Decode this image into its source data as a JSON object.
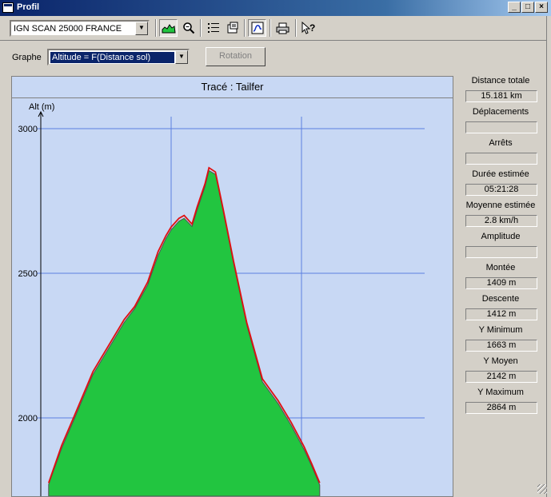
{
  "window": {
    "title": "Profil"
  },
  "toolbar": {
    "map_select": "IGN SCAN 25000 FRANCE",
    "icons": [
      "profile-icon",
      "zoom-icon",
      "list-icon",
      "properties-icon",
      "track-icon",
      "print-icon",
      "help-icon"
    ]
  },
  "graph": {
    "label": "Graphe",
    "select_value": "Altitude = F(Distance sol)",
    "rotation_label": "Rotation"
  },
  "chart_data": {
    "type": "area",
    "title": "Tracé : Tailfer",
    "ylabel": "Alt (m)",
    "xlabel": "",
    "y_ticks": [
      "3000",
      "2500",
      "2000"
    ],
    "ylim": [
      1750,
      3000
    ],
    "x_gridlines": [
      5,
      10
    ],
    "xlim": [
      0,
      14.7
    ],
    "grid": true,
    "series": [
      {
        "color": "#e01010",
        "x": [
          0.3,
          0.8,
          1.3,
          2.0,
          2.7,
          3.2,
          3.6,
          4.1,
          4.5,
          4.8,
          5.0,
          5.3,
          5.5,
          5.8,
          6.0,
          6.3,
          6.45,
          6.7,
          7.0,
          7.4,
          7.9,
          8.5,
          9.1,
          9.6,
          10.1,
          10.4,
          10.7
        ],
        "y": [
          1775,
          1905,
          2010,
          2160,
          2265,
          2340,
          2385,
          2470,
          2575,
          2630,
          2660,
          2690,
          2700,
          2670,
          2730,
          2810,
          2865,
          2850,
          2720,
          2540,
          2330,
          2135,
          2060,
          1985,
          1900,
          1840,
          1775
        ]
      },
      {
        "color": "#22c540",
        "x": [
          0.3,
          0.8,
          1.3,
          2.0,
          2.7,
          3.2,
          3.6,
          4.1,
          4.5,
          4.8,
          5.0,
          5.3,
          5.5,
          5.8,
          6.0,
          6.3,
          6.45,
          6.7,
          7.0,
          7.4,
          7.9,
          8.5,
          9.1,
          9.6,
          10.1,
          10.4,
          10.7
        ],
        "y": [
          1770,
          1895,
          2000,
          2150,
          2255,
          2330,
          2378,
          2460,
          2562,
          2620,
          2650,
          2680,
          2690,
          2662,
          2720,
          2800,
          2855,
          2842,
          2712,
          2532,
          2322,
          2125,
          2050,
          1975,
          1890,
          1832,
          1768
        ]
      }
    ]
  },
  "stats": [
    {
      "label": "Distance totale",
      "value": "15.181 km"
    },
    {
      "label": "Déplacements",
      "value": ""
    },
    {
      "label": "Arrêts",
      "value": ""
    },
    {
      "label": "Durée estimée",
      "value": "05:21:28"
    },
    {
      "label": "Moyenne estimée",
      "value": "2.8 km/h"
    },
    {
      "label": "Amplitude",
      "value": ""
    },
    {
      "label": "Montée",
      "value": "1409 m"
    },
    {
      "label": "Descente",
      "value": "1412 m"
    },
    {
      "label": "Y Minimum",
      "value": "1663 m"
    },
    {
      "label": "Y Moyen",
      "value": "2142 m"
    },
    {
      "label": "Y Maximum",
      "value": "2864 m"
    }
  ]
}
